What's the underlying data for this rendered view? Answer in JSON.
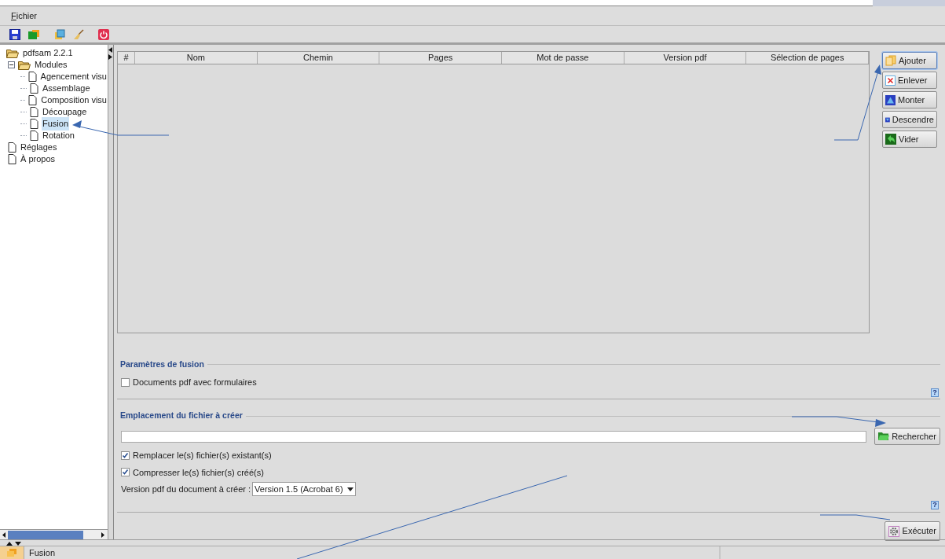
{
  "menu": [
    {
      "label": "Fichier"
    }
  ],
  "toolbar": [
    {
      "kind": "save"
    },
    {
      "kind": "folder"
    },
    {
      "kind": "env"
    },
    {
      "kind": "clean"
    },
    {
      "kind": "power"
    }
  ],
  "tree": {
    "label": "pdfsam 2.2.1",
    "selected": false,
    "children": [
      {
        "label": "Modules",
        "expanded": true,
        "selected": false,
        "children": [
          {
            "label": "Agencement visu",
            "selected": false
          },
          {
            "label": "Assemblage",
            "selected": false
          },
          {
            "label": "Composition visu",
            "selected": false
          },
          {
            "label": "Découpage",
            "selected": false
          },
          {
            "label": "Fusion",
            "selected": true
          },
          {
            "label": "Rotation",
            "selected": false
          }
        ]
      },
      {
        "label": "Réglages",
        "selected": false
      },
      {
        "label": "À propos",
        "selected": false
      }
    ]
  },
  "table": {
    "columns": [
      "#",
      "Nom",
      "Chemin",
      "Pages",
      "Mot de passe",
      "Version pdf",
      "Sélection de pages"
    ]
  },
  "side_buttons": [
    {
      "label": "Ajouter",
      "kind": "add",
      "selected": true
    },
    {
      "label": "Enlever",
      "kind": "remove",
      "selected": false
    },
    {
      "label": "Monter",
      "kind": "up",
      "selected": false
    },
    {
      "label": "Descendre",
      "kind": "down",
      "selected": false
    },
    {
      "label": "Vider",
      "kind": "clear",
      "selected": false
    }
  ],
  "merge_group": {
    "title": "Paramètres de fusion",
    "options": [
      {
        "label": "Documents pdf avec formulaires",
        "checked": false
      }
    ],
    "help": "?"
  },
  "destination_group": {
    "title": "Emplacement du fichier à créer",
    "browse_button": "Rechercher",
    "options": [
      {
        "label": "Remplacer le(s) fichier(s) existant(s)",
        "checked": true
      },
      {
        "label": "Compresser le(s) fichier(s) créé(s)",
        "checked": true
      }
    ],
    "version_label": "Version pdf du document à créer :",
    "version_value": "Version 1.5 (Acrobat 6)",
    "help": "?"
  },
  "run_button": "Exécuter",
  "status_bar": {
    "text": "Fusion"
  }
}
